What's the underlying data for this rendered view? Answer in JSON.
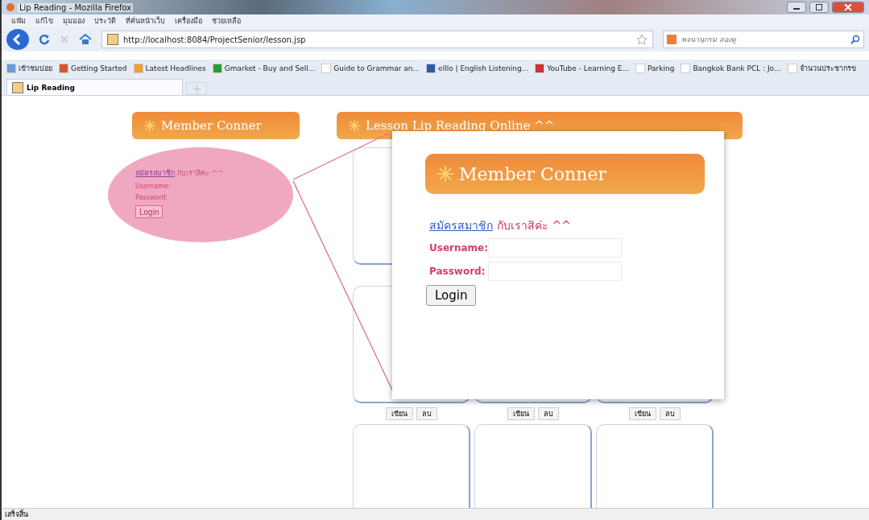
{
  "window": {
    "title": "Lip Reading - Mozilla Firefox"
  },
  "menu": [
    "แฟ้ม",
    "แก้ไข",
    "มุมมอง",
    "ประวัติ",
    "ที่คั่นหน้าเว็บ",
    "เครื่องมือ",
    "ช่วยเหลือ"
  ],
  "toolbar": {
    "url": "http://localhost:8084/ProjectSenior/lesson.jsp",
    "search_placeholder": "พจนานุกรม ลองดู"
  },
  "bookmarks": [
    {
      "label": "เข้าชมบ่อย",
      "kind": "folder"
    },
    {
      "label": "Getting Started",
      "kind": "fox"
    },
    {
      "label": "Latest Headlines",
      "kind": "rss"
    },
    {
      "label": "Gmarket - Buy and Sell...",
      "kind": "g"
    },
    {
      "label": "Guide to Grammar an...",
      "kind": "page"
    },
    {
      "label": "elllo | English Listening...",
      "kind": "elllo"
    },
    {
      "label": "YouTube - Learning E...",
      "kind": "youtube"
    },
    {
      "label": "Parking",
      "kind": "page"
    },
    {
      "label": "Bangkok Bank PCL : Jo...",
      "kind": "page"
    },
    {
      "label": "จำนวนประชากรข",
      "kind": "page"
    }
  ],
  "tabs": [
    {
      "label": "Lip Reading",
      "selected": true
    }
  ],
  "member_panel": {
    "header": "Member Conner",
    "register_link": "สมัครสมาชิก",
    "register_text": "กับเราสิค่ะ ^^",
    "username_label": "Username:",
    "password_label": "Password:",
    "login_button": "Login"
  },
  "lesson_panel": {
    "header": "Lesson Lip Reading Online ^^",
    "card_rows": [
      {
        "kind": "covered"
      },
      {
        "kind": "with_buttons",
        "card_buttons": [
          [
            "เขียน",
            "ลบ"
          ],
          [
            "เขียน",
            "ลบ"
          ],
          [
            "เขียน",
            "ลบ"
          ]
        ]
      },
      {
        "kind": "cut"
      }
    ]
  },
  "zoom_popup": {
    "header": "Member Conner",
    "register_link": "สมัครสมาชิก",
    "register_text": "กับเราสิค่ะ ^^",
    "username_label": "Username:",
    "password_label": "Password:",
    "login_button": "Login"
  },
  "status_bar": "เสร็จสิ้น"
}
